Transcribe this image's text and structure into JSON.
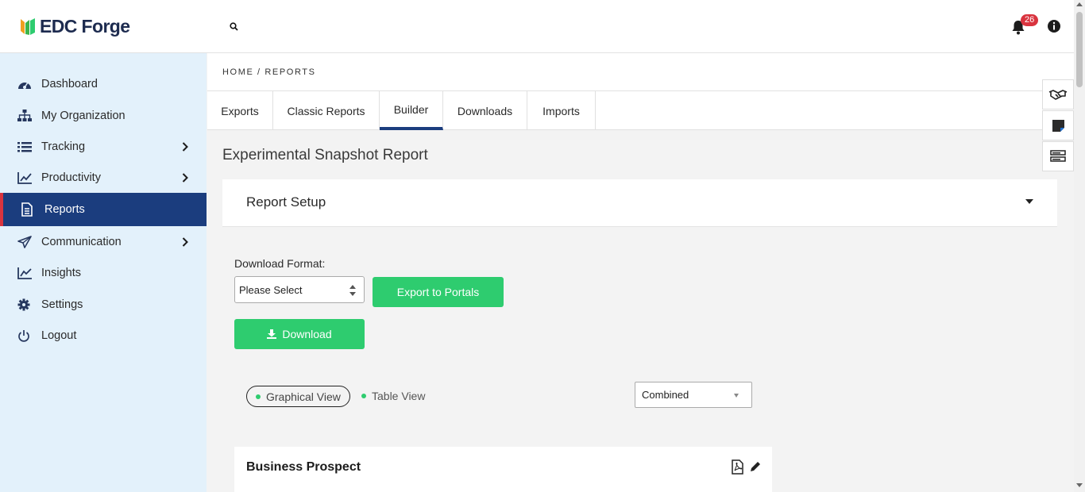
{
  "app": {
    "logo_text": "EDC Forge",
    "notifications_count": "26",
    "accent_color": "#1b3d7e",
    "green_color": "#2ecc6f"
  },
  "sidebar": {
    "items": [
      {
        "label": "Dashboard",
        "icon": "dashboard-icon",
        "has_submenu": false
      },
      {
        "label": "My Organization",
        "icon": "sitemap-icon",
        "has_submenu": false
      },
      {
        "label": "Tracking",
        "icon": "list-icon",
        "has_submenu": true
      },
      {
        "label": "Productivity",
        "icon": "chart-line-icon",
        "has_submenu": true
      },
      {
        "label": "Reports",
        "icon": "document-icon",
        "has_submenu": false,
        "active": true
      },
      {
        "label": "Communication",
        "icon": "paper-plane-icon",
        "has_submenu": true
      },
      {
        "label": "Insights",
        "icon": "chart-area-icon",
        "has_submenu": false
      },
      {
        "label": "Settings",
        "icon": "gear-icon",
        "has_submenu": false
      },
      {
        "label": "Logout",
        "icon": "power-icon",
        "has_submenu": false
      }
    ]
  },
  "breadcrumb": "HOME / REPORTS",
  "tabs": [
    {
      "label": "Exports"
    },
    {
      "label": "Classic Reports"
    },
    {
      "label": "Builder",
      "active": true
    },
    {
      "label": "Downloads"
    },
    {
      "label": "Imports"
    }
  ],
  "main": {
    "page_title": "Experimental Snapshot Report",
    "setup_title": "Report Setup",
    "download_format_label": "Download Format:",
    "download_format_value": "Please Select",
    "export_button": "Export to Portals",
    "download_button": "Download",
    "view_graphical": "Graphical View",
    "view_table": "Table View",
    "combined_value": "Combined",
    "card_title": "Business Prospect"
  }
}
